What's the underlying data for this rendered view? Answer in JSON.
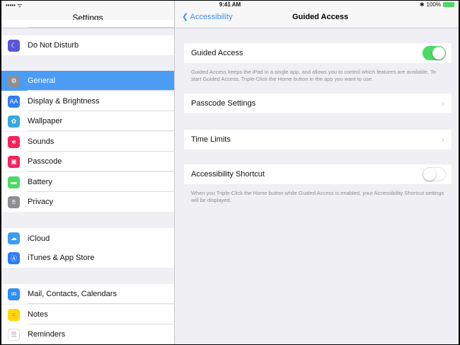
{
  "status_bar": {
    "time": "9:41 AM",
    "signal": "••••• ᯤ",
    "bluetooth": "✱",
    "battery": "100%"
  },
  "sidebar": {
    "title": "Settings",
    "groups": [
      [
        {
          "label": "Do Not Disturb",
          "icon": "moon-icon",
          "color": "#5856d6"
        }
      ],
      [
        {
          "label": "General",
          "icon": "gear-icon",
          "color": "#8e8e93",
          "selected": true
        },
        {
          "label": "Display & Brightness",
          "icon": "text-size-icon",
          "color": "#2f7cf6"
        },
        {
          "label": "Wallpaper",
          "icon": "flower-icon",
          "color": "#35aadc"
        },
        {
          "label": "Sounds",
          "icon": "speaker-icon",
          "color": "#f7245a"
        },
        {
          "label": "Passcode",
          "icon": "lock-icon",
          "color": "#f7245a"
        },
        {
          "label": "Battery",
          "icon": "battery-icon",
          "color": "#4cd964"
        },
        {
          "label": "Privacy",
          "icon": "hand-icon",
          "color": "#8e8e93"
        }
      ],
      [
        {
          "label": "iCloud",
          "icon": "cloud-icon",
          "color": "#3b9cf0"
        },
        {
          "label": "iTunes & App Store",
          "icon": "app-store-icon",
          "color": "#2f7cf6"
        }
      ],
      [
        {
          "label": "Mail, Contacts, Calendars",
          "icon": "mail-icon",
          "color": "#2f8df6"
        },
        {
          "label": "Notes",
          "icon": "notes-icon",
          "color": "#ffd60a"
        },
        {
          "label": "Reminders",
          "icon": "reminders-icon",
          "color": "#ffffff"
        }
      ]
    ]
  },
  "main": {
    "back_label": "Accessibility",
    "title": "Guided Access",
    "guided_access": {
      "label": "Guided Access",
      "on": true
    },
    "guided_note": "Guided Access keeps the iPad in a single app, and allows you to control which features are available. To start Guided Access, Triple-Click the Home button in the app you want to use.",
    "passcode_settings": "Passcode Settings",
    "time_limits": "Time Limits",
    "shortcut": {
      "label": "Accessibility Shortcut",
      "on": false
    },
    "shortcut_note": "When you Triple-Click the Home button while Guided Access is enabled, your Accessibility Shortcut settings will be displayed."
  }
}
